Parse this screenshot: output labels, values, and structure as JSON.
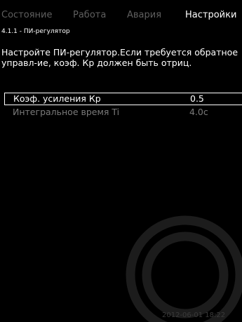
{
  "tabs": [
    {
      "label": "Состояние",
      "active": false
    },
    {
      "label": "Работа",
      "active": false
    },
    {
      "label": "Авария",
      "active": false
    },
    {
      "label": "Настройки",
      "active": true
    }
  ],
  "breadcrumb": "4.1.1 - ПИ-регулятор",
  "description": "Настройте ПИ-регулятор.Если требуется обратное управл-ие, коэф. Кр должен быть отриц.",
  "parameters": [
    {
      "name": "Коэф. усиления Кр",
      "value": "0.5",
      "selected": true
    },
    {
      "name": "Интегральное время Ti",
      "value": "4.0c",
      "selected": false
    }
  ],
  "timestamp": "2012-06-01 18:22",
  "colors": {
    "background": "#000000",
    "active_text": "#ffffff",
    "inactive_tab": "#5f5f5f",
    "inactive_param": "#7a7a7a",
    "ring": "#1c1c1c"
  }
}
